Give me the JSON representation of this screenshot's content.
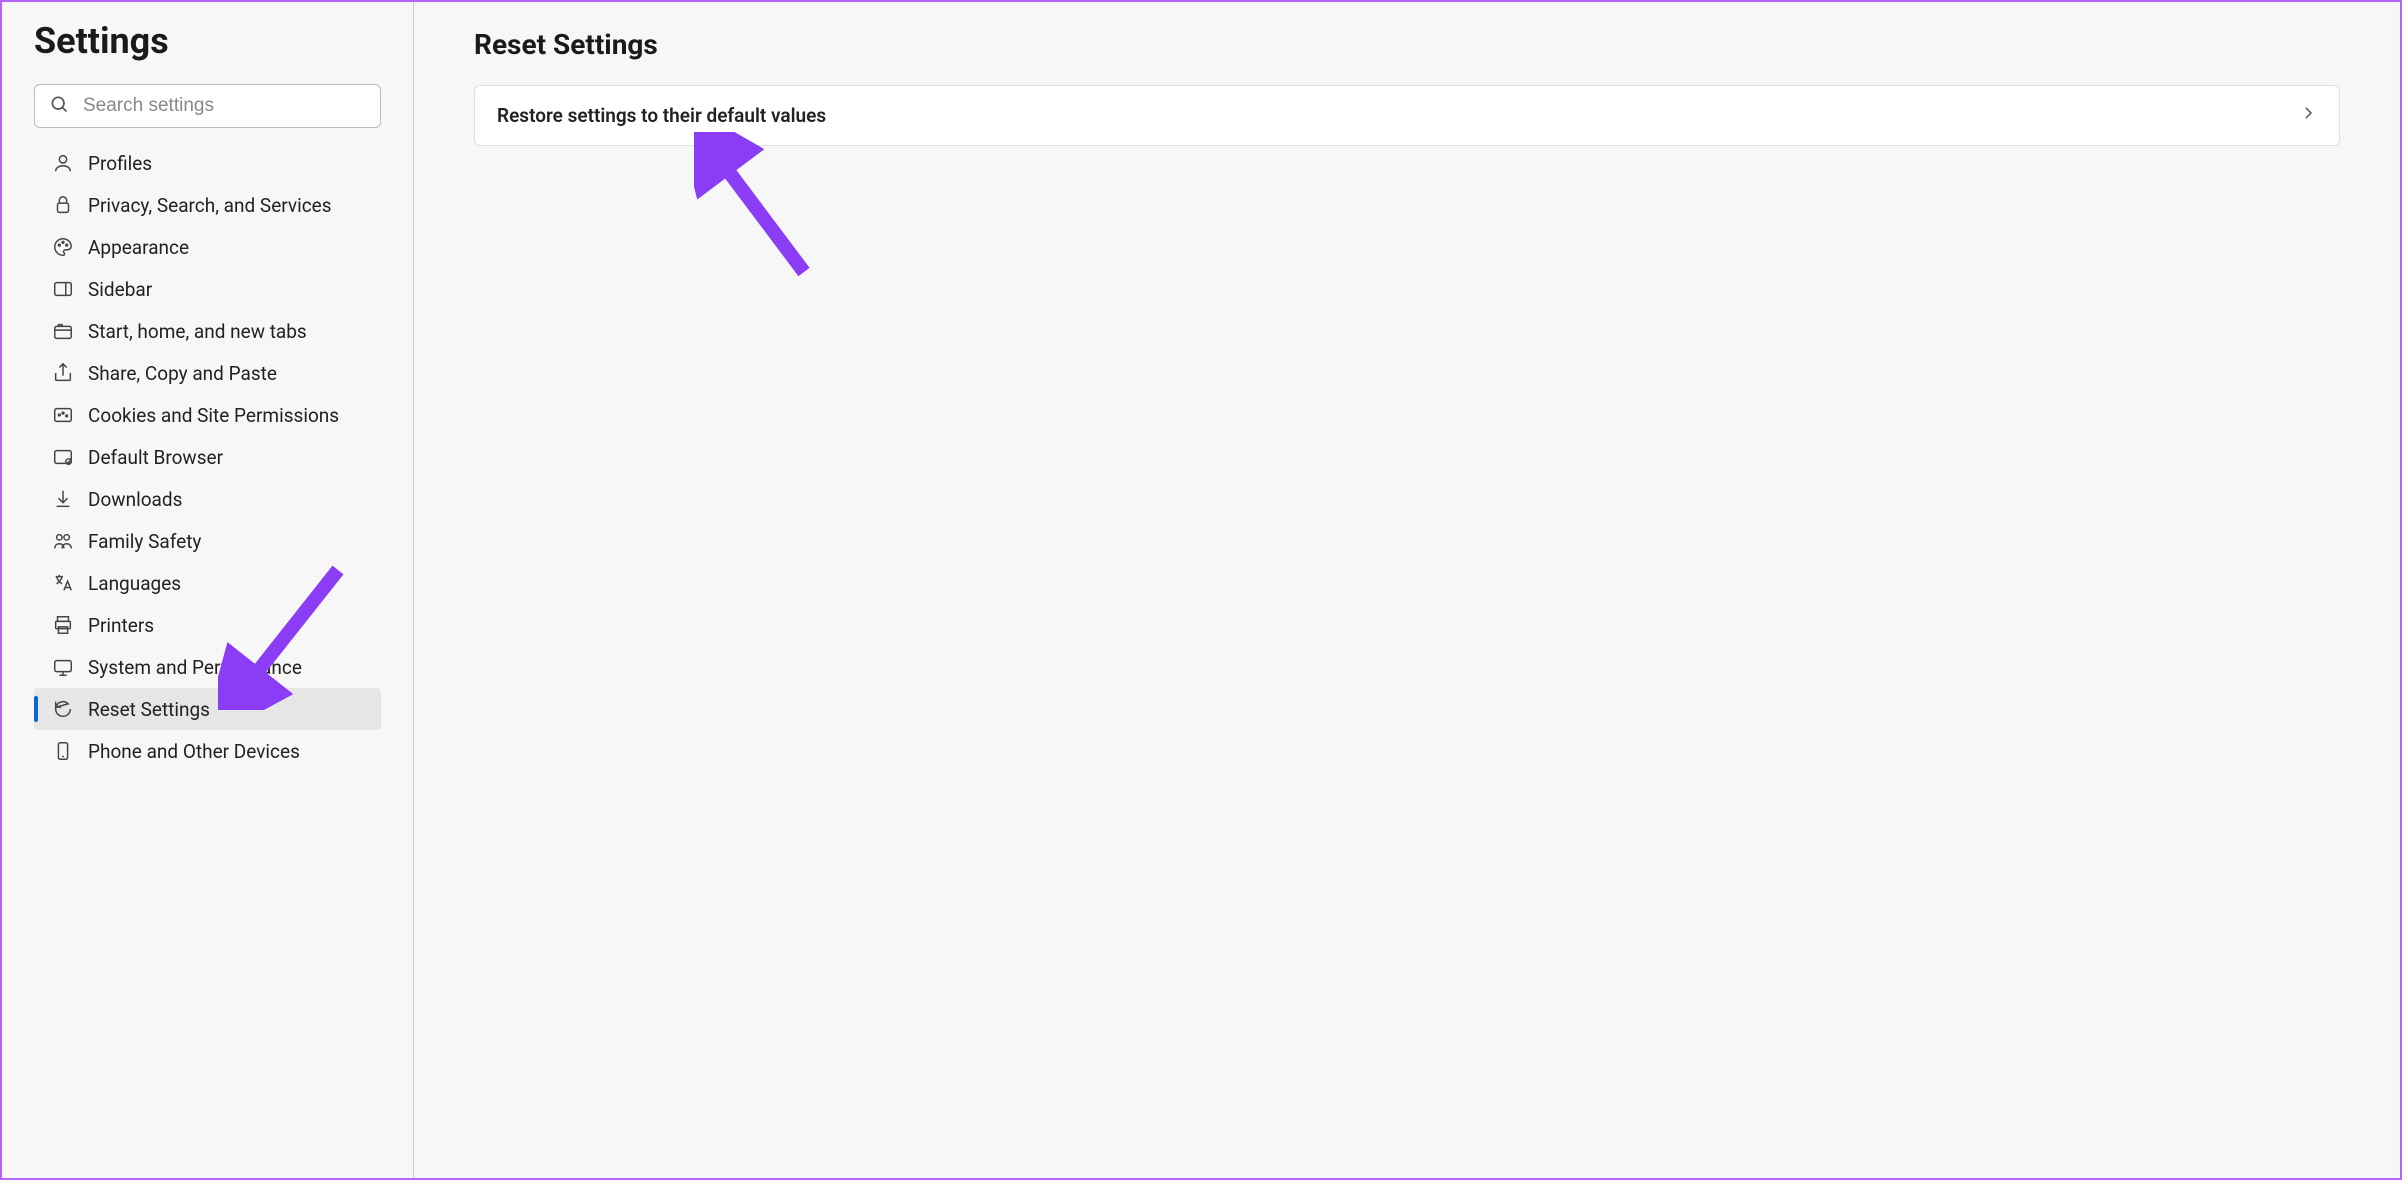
{
  "sidebar": {
    "title": "Settings",
    "search_placeholder": "Search settings",
    "items": [
      {
        "label": "Profiles",
        "icon": "profile-icon",
        "selected": false
      },
      {
        "label": "Privacy, Search, and Services",
        "icon": "lock-icon",
        "selected": false
      },
      {
        "label": "Appearance",
        "icon": "palette-icon",
        "selected": false
      },
      {
        "label": "Sidebar",
        "icon": "sidebar-icon",
        "selected": false
      },
      {
        "label": "Start, home, and new tabs",
        "icon": "tabs-icon",
        "selected": false
      },
      {
        "label": "Share, Copy and Paste",
        "icon": "share-icon",
        "selected": false
      },
      {
        "label": "Cookies and Site Permissions",
        "icon": "cookies-icon",
        "selected": false
      },
      {
        "label": "Default Browser",
        "icon": "default-icon",
        "selected": false
      },
      {
        "label": "Downloads",
        "icon": "download-icon",
        "selected": false
      },
      {
        "label": "Family Safety",
        "icon": "family-icon",
        "selected": false
      },
      {
        "label": "Languages",
        "icon": "language-icon",
        "selected": false
      },
      {
        "label": "Printers",
        "icon": "printer-icon",
        "selected": false
      },
      {
        "label": "System and Performance",
        "icon": "system-icon",
        "selected": false
      },
      {
        "label": "Reset Settings",
        "icon": "reset-icon",
        "selected": true
      },
      {
        "label": "Phone and Other Devices",
        "icon": "phone-icon",
        "selected": false
      }
    ]
  },
  "main": {
    "title": "Reset Settings",
    "rows": [
      {
        "label": "Restore settings to their default values"
      }
    ]
  },
  "annotations": {
    "arrow_color": "#8a3df5"
  }
}
